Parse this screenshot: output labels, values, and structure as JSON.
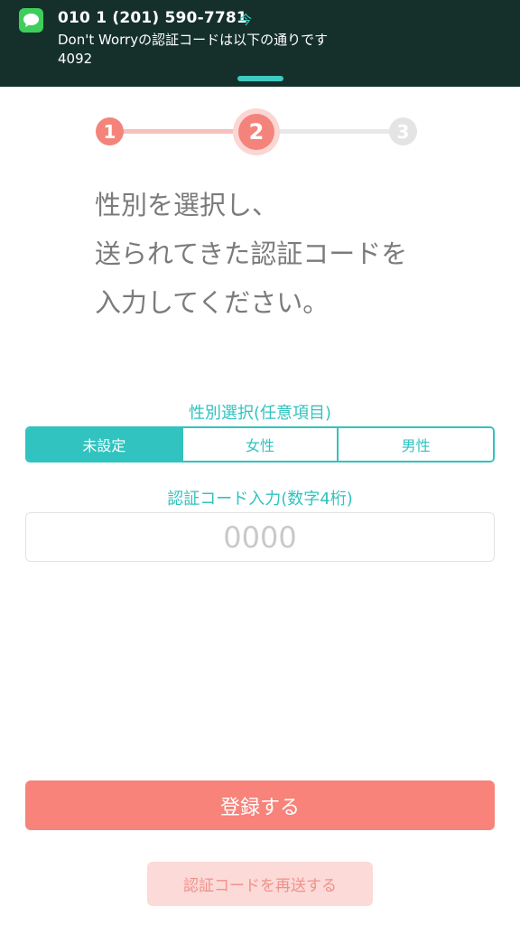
{
  "notification": {
    "icon": "messages-icon",
    "sender": "010 1 (201) 590-7781",
    "time": "今",
    "message_line1": "Don't Worryの認証コードは以下の通りです",
    "message_line2": "4092"
  },
  "steps": {
    "items": [
      "1",
      "2",
      "3"
    ],
    "current": 2,
    "colors": {
      "active": "#f4847b",
      "done_bar": "#f6c1bd",
      "inactive": "#e4e4e4"
    }
  },
  "instruction": {
    "lines": [
      "性別を選択し、",
      "送られてきた認証コードを",
      "入力してください。"
    ]
  },
  "gender": {
    "label": "性別選択(任意項目)",
    "options": [
      "未設定",
      "女性",
      "男性"
    ],
    "selected": "未設定"
  },
  "code": {
    "label": "認証コード入力(数字4桁)",
    "value": "",
    "placeholder": "0000"
  },
  "buttons": {
    "register": "登録する",
    "resend": "認証コードを再送する"
  },
  "colors": {
    "accent_teal": "#31c3bf",
    "primary_coral": "#f7837a",
    "banner_bg": "#15302b"
  }
}
